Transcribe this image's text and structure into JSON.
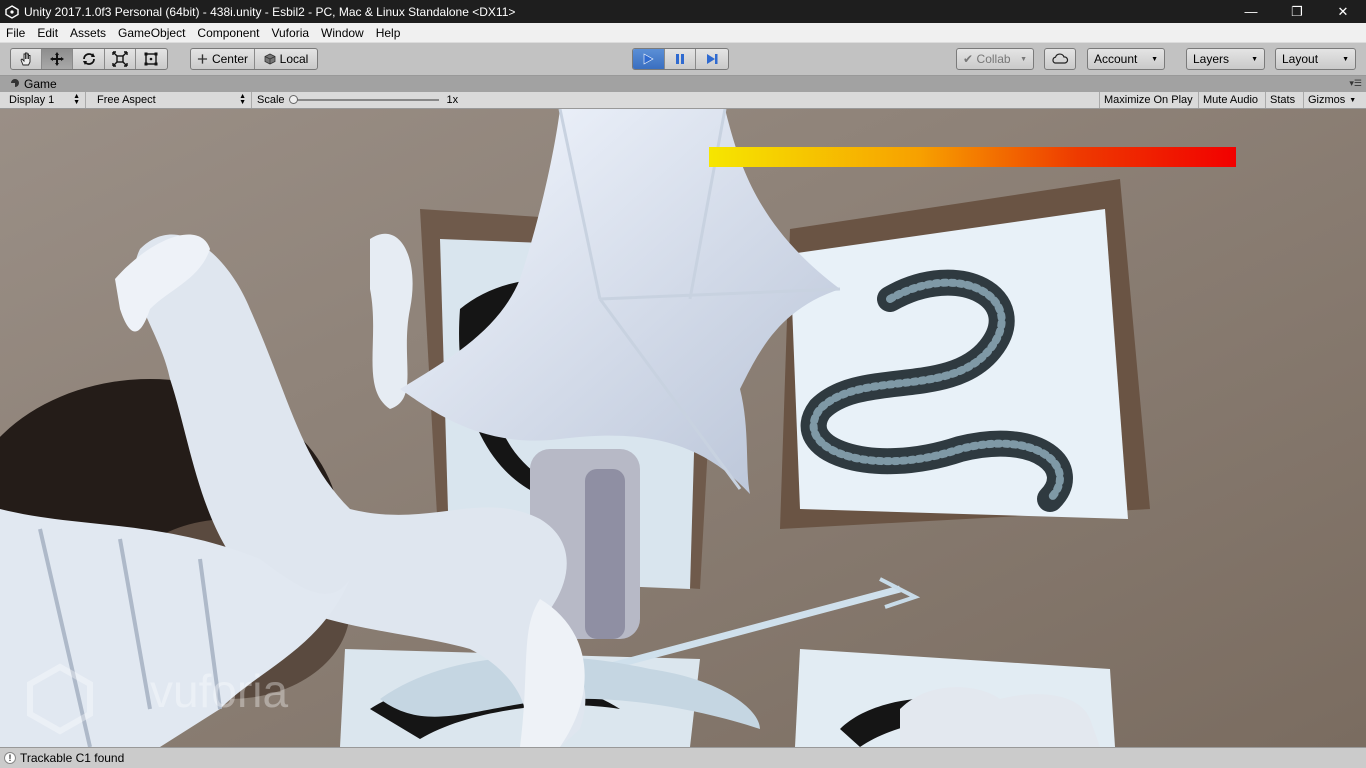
{
  "window": {
    "title": "Unity 2017.1.0f3 Personal (64bit) - 438i.unity - Esbil2 - PC, Mac & Linux Standalone <DX11>",
    "controls": {
      "minimize": "—",
      "restore": "❐",
      "close": "✕"
    }
  },
  "menu": [
    "File",
    "Edit",
    "Assets",
    "GameObject",
    "Component",
    "Vuforia",
    "Window",
    "Help"
  ],
  "toolbar": {
    "transform_tools": [
      "hand-icon",
      "move-icon",
      "rotate-icon",
      "scale-icon",
      "rect-icon"
    ],
    "pivot": "Center",
    "space": "Local",
    "collab": "Collab",
    "account": "Account",
    "layers": "Layers",
    "layout": "Layout"
  },
  "tab": {
    "label": "Game"
  },
  "game_bar": {
    "display": "Display 1",
    "aspect": "Free Aspect",
    "scale_label": "Scale",
    "scale_value": "1x",
    "maximize": "Maximize On Play",
    "mute": "Mute Audio",
    "stats": "Stats",
    "gizmos": "Gizmos"
  },
  "viewport": {
    "watermark": "vuforia",
    "health_bar_colors": [
      "#f6e600",
      "#f20000"
    ]
  },
  "status": {
    "message": "Trackable C1 found"
  }
}
